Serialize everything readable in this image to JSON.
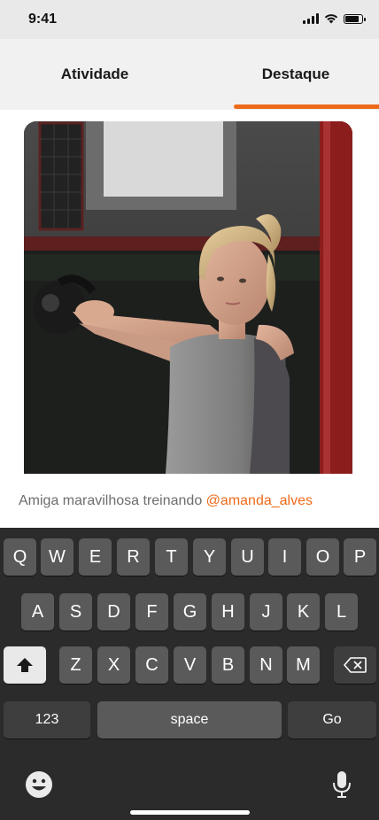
{
  "status_bar": {
    "time": "9:41"
  },
  "tabs": [
    {
      "label": "Atividade",
      "selected": false
    },
    {
      "label": "Destaque",
      "selected": true
    }
  ],
  "colors": {
    "accent": "#ee6a1a",
    "caption": "#6d6d6d",
    "keyboard_bg": "#2b2b2b",
    "key_bg": "#5a5a5a"
  },
  "post": {
    "caption_text": "Amiga maravilhosa treinando ",
    "mention": "@amanda_alves"
  },
  "keyboard": {
    "row1": [
      "Q",
      "W",
      "E",
      "R",
      "T",
      "Y",
      "U",
      "I",
      "O",
      "P"
    ],
    "row2": [
      "A",
      "S",
      "D",
      "F",
      "G",
      "H",
      "J",
      "K",
      "L"
    ],
    "row3": [
      "Z",
      "X",
      "C",
      "V",
      "B",
      "N",
      "M"
    ],
    "numbers_label": "123",
    "space_label": "space",
    "go_label": "Go"
  },
  "icons": {
    "shift": "shift-icon",
    "backspace": "backspace-icon",
    "emoji": "emoji-icon",
    "mic": "microphone-icon"
  }
}
